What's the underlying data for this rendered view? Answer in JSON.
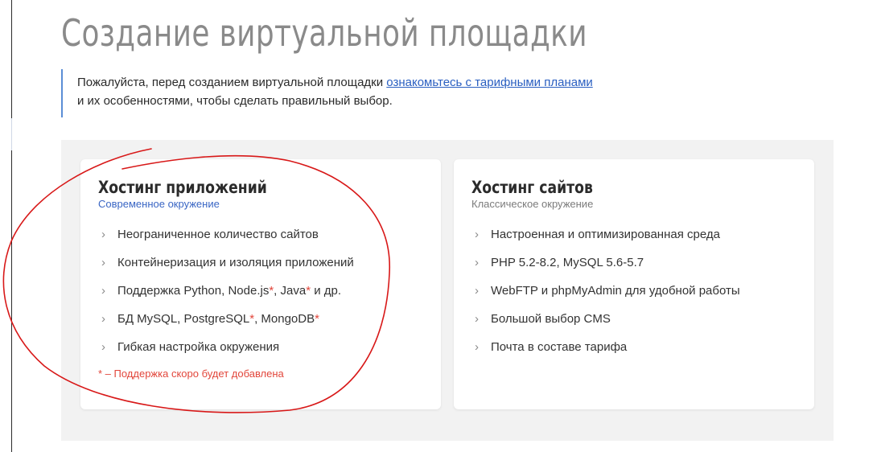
{
  "page": {
    "title": "Создание виртуальной площадки"
  },
  "intro": {
    "text_before": "Пожалуйста, перед созданием виртуальной площадки ",
    "link_text": "ознакомьтесь с тарифными планами",
    "text_after": "и их особенностями, чтобы сделать правильный выбор."
  },
  "cards": [
    {
      "title": "Хостинг приложений",
      "subtitle": "Современное окружение",
      "features": [
        {
          "parts": [
            {
              "text": "Неограниченное количество сайтов"
            }
          ]
        },
        {
          "parts": [
            {
              "text": "Контейнеризация и изоляция приложений"
            }
          ]
        },
        {
          "parts": [
            {
              "text": "Поддержка Python, Node.js"
            },
            {
              "text": "*",
              "star": true
            },
            {
              "text": ", Java"
            },
            {
              "text": "*",
              "star": true
            },
            {
              "text": " и др."
            }
          ]
        },
        {
          "parts": [
            {
              "text": "БД MySQL, PostgreSQL"
            },
            {
              "text": "*",
              "star": true
            },
            {
              "text": ", MongoDB"
            },
            {
              "text": "*",
              "star": true
            }
          ]
        },
        {
          "parts": [
            {
              "text": "Гибкая настройка окружения"
            }
          ]
        }
      ],
      "footnote": "* – Поддержка скоро будет добавлена"
    },
    {
      "title": "Хостинг сайтов",
      "subtitle": "Классическое окружение",
      "features": [
        {
          "parts": [
            {
              "text": "Настроенная и оптимизированная среда"
            }
          ]
        },
        {
          "parts": [
            {
              "text": "PHP 5.2-8.2, MySQL 5.6-5.7"
            }
          ]
        },
        {
          "parts": [
            {
              "text": "WebFTP и phpMyAdmin для удобной работы"
            }
          ]
        },
        {
          "parts": [
            {
              "text": "Большой выбор CMS"
            }
          ]
        },
        {
          "parts": [
            {
              "text": "Почта в составе тарифа"
            }
          ]
        }
      ]
    }
  ],
  "icons": {
    "bullet": "chevron-right-icon",
    "chevron_glyph": "›"
  },
  "colors": {
    "title_gray": "#8a8a8a",
    "link_blue": "#2a5fc1",
    "accent_bar_blue": "#5b8ed6",
    "subtitle_blue": "#3a66c4",
    "star_red": "#e2463b",
    "annotation_red": "#d81818",
    "panel_bg": "#f2f2f2"
  }
}
